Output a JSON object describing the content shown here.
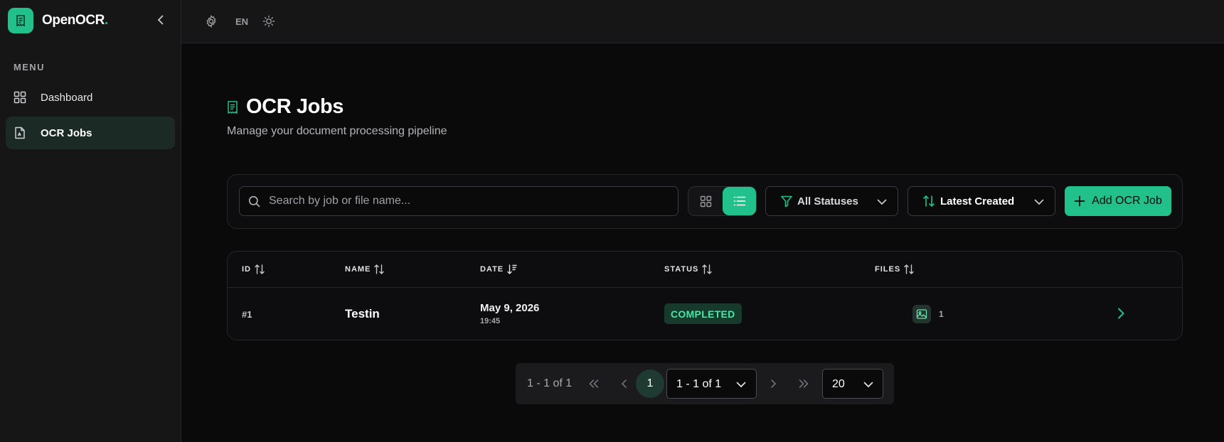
{
  "app": {
    "name": "OpenOCR",
    "name_dot": ".",
    "accent_color": "#22c08a"
  },
  "sidebar": {
    "menu_label": "MENU",
    "items": [
      {
        "label": "Dashboard",
        "icon": "grid-icon",
        "active": false
      },
      {
        "label": "OCR Jobs",
        "icon": "file-icon",
        "active": true
      }
    ]
  },
  "topbar": {
    "language": "EN",
    "icons": [
      "gear-icon",
      "sun-icon"
    ]
  },
  "page": {
    "title": "OCR Jobs",
    "subtitle": "Manage your document processing pipeline"
  },
  "toolbar": {
    "search_placeholder": "Search by job or file name...",
    "search_value": "",
    "view_mode": "list",
    "status_filter": "All Statuses",
    "sort": "Latest Created",
    "add_label": "Add OCR Job"
  },
  "table": {
    "columns": [
      "ID",
      "NAME",
      "DATE",
      "STATUS",
      "FILES"
    ],
    "rows": [
      {
        "id": "#1",
        "name": "Testin",
        "date": "May 9, 2026",
        "time": "19:45",
        "status": "COMPLETED",
        "files": "1"
      }
    ]
  },
  "pagination": {
    "range_text": "1 - 1 of 1",
    "current_page": "1",
    "page_select": "1 - 1 of 1",
    "page_size": "20"
  }
}
